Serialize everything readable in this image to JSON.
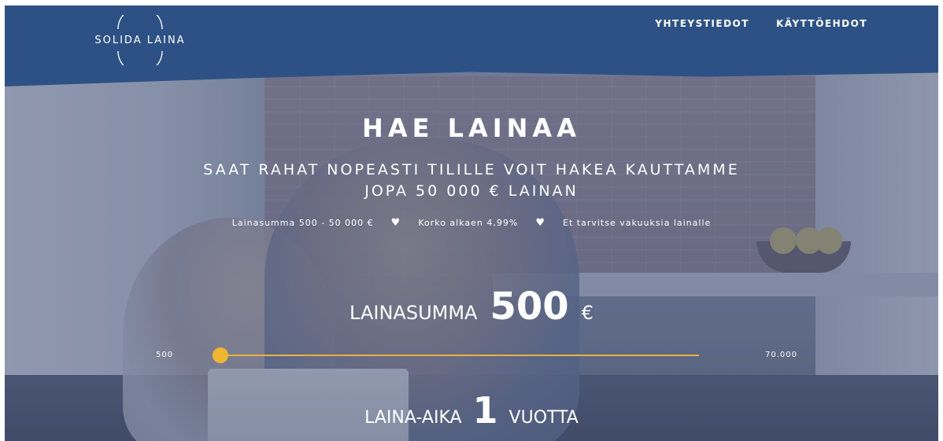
{
  "header": {
    "logo_text": "SOLIDA LAINA",
    "nav": [
      {
        "label": "YHTEYSTIEDOT"
      },
      {
        "label": "KÄYTTÖEHDOT"
      }
    ]
  },
  "hero": {
    "title": "HAE LAINAA",
    "subtitle_line1": "SAAT RAHAT NOPEASTI TILILLE VOIT HAKEA KAUTTAMME",
    "subtitle_line2": "JOPA 50 000 € LAINAN",
    "features": [
      "Lainasumma 500 - 50 000 €",
      "Korko alkaen 4,99%",
      "Et tarvitse vakuuksia lainalle"
    ],
    "feature_separator_icon": "heart-icon"
  },
  "loan_amount": {
    "label": "LAINASUMMA",
    "value": "500",
    "unit": "€",
    "slider_min": "500",
    "slider_max": "70.000",
    "slider_fraction": 0.0
  },
  "loan_term": {
    "label": "LAINA-AIKA",
    "value": "1",
    "unit": "VUOTTA"
  },
  "colors": {
    "header_bg": "#2d5184",
    "accent": "#f0b531"
  }
}
